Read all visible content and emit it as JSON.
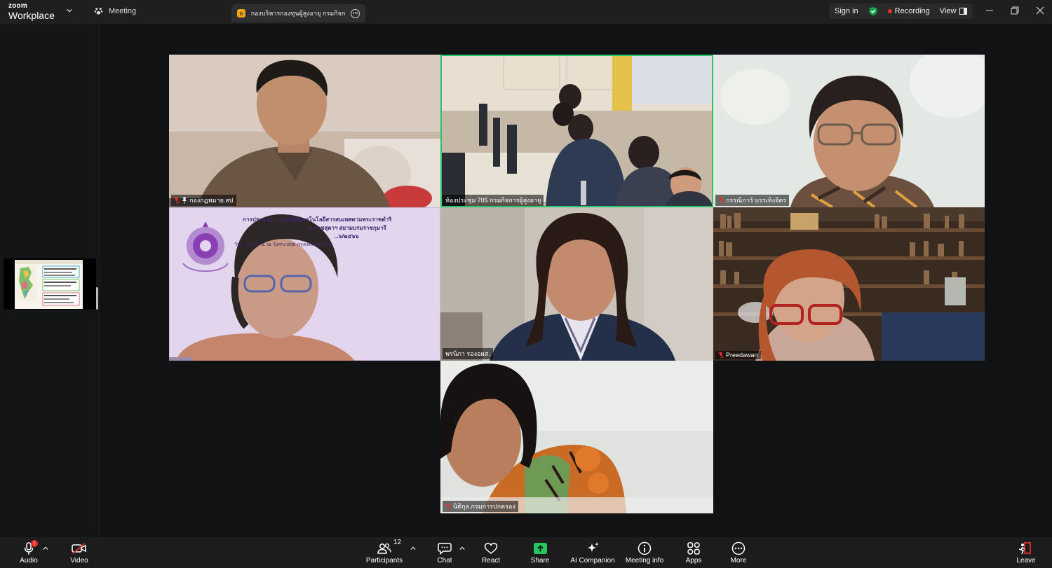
{
  "app": {
    "logo_top": "zoom",
    "logo_bottom": "Workplace",
    "meeting_menu_label": "Meeting"
  },
  "tab": {
    "title": "กองบริหารกองทุนผู้สูงอายุ กรมกิจการผู้ส",
    "icon_letter": "ก"
  },
  "header": {
    "sign_in": "Sign in",
    "recording": "Recording",
    "view": "View"
  },
  "participants": [
    {
      "name": "กองกฎหมาย.สป",
      "muted": true,
      "pinned": true
    },
    {
      "name": "ห้องประชุม 705 กรมกิจการผู้สูงอายุ",
      "muted": false,
      "active_speaker": true
    },
    {
      "name": "กรรณิการ์ บรรเทิงจิตร",
      "muted": true
    },
    {
      "name": "",
      "muted": false
    },
    {
      "name": "พรนิภา รองอผส.",
      "muted": false
    },
    {
      "name": "Preedawan",
      "muted": true
    },
    {
      "name": "นิติกุล.กรมการปกครอง",
      "muted": true
    }
  ],
  "slide": {
    "line1": "การประชุมอ... กรมอนิธิเทคโนโลยีสารสนเทศตามพระราชดำริ",
    "line2": "...นราชสุดาฯ สยามบรมราชกุมารี",
    "line3": "...๖/๒๕๖๖",
    "line4": "วัน... ๑๑.๐๐ น. ณ วังสระปทุม กรุงเทพมหานคร"
  },
  "toolbar": {
    "audio": "Audio",
    "audio_badge": "!",
    "video": "Video",
    "participants": "Participants",
    "participants_count": "12",
    "chat": "Chat",
    "react": "React",
    "share": "Share",
    "ai_companion": "AI Companion",
    "meeting_info": "Meeting info",
    "apps": "Apps",
    "more": "More",
    "leave": "Leave"
  },
  "colors": {
    "active_speaker_border": "#27c46b",
    "recording_dot": "#e5302f",
    "share_green": "#22c55e",
    "shield_green": "#16a34a"
  }
}
